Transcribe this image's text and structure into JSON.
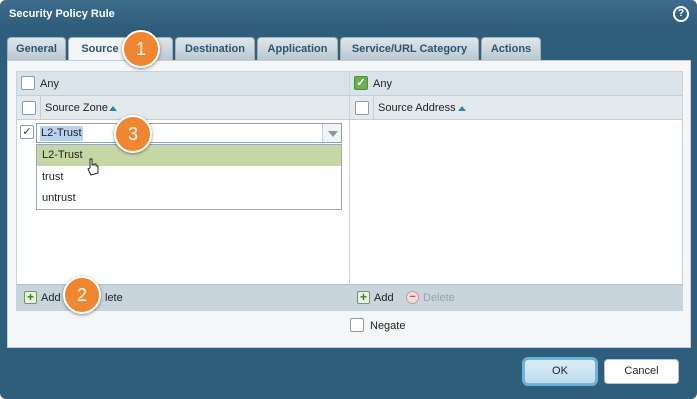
{
  "dialog": {
    "title": "Security Policy Rule",
    "help_label": "?"
  },
  "tabs": [
    {
      "label": "General"
    },
    {
      "label": "Source",
      "active": true
    },
    {
      "label": "User"
    },
    {
      "label": "Destination"
    },
    {
      "label": "Application"
    },
    {
      "label": "Service/URL Category"
    },
    {
      "label": "Actions"
    }
  ],
  "source_zone_panel": {
    "any_label": "Any",
    "any_checked": false,
    "column_header": "Source Zone",
    "selected_value": "L2-Trust",
    "dropdown_options": [
      "L2-Trust",
      "trust",
      "untrust"
    ],
    "hovered_option": "L2-Trust",
    "add_label": "Add",
    "delete_label": "Delete"
  },
  "source_address_panel": {
    "any_label": "Any",
    "any_checked": true,
    "column_header": "Source Address",
    "add_label": "Add",
    "delete_label": "Delete",
    "negate_label": "Negate"
  },
  "buttons": {
    "ok": "OK",
    "cancel": "Cancel"
  },
  "callouts": [
    "1",
    "2",
    "3"
  ],
  "colors": {
    "accent": "#f0862f",
    "title_bar": "#2f5e7c",
    "hover_row": "#c6d7a6"
  }
}
